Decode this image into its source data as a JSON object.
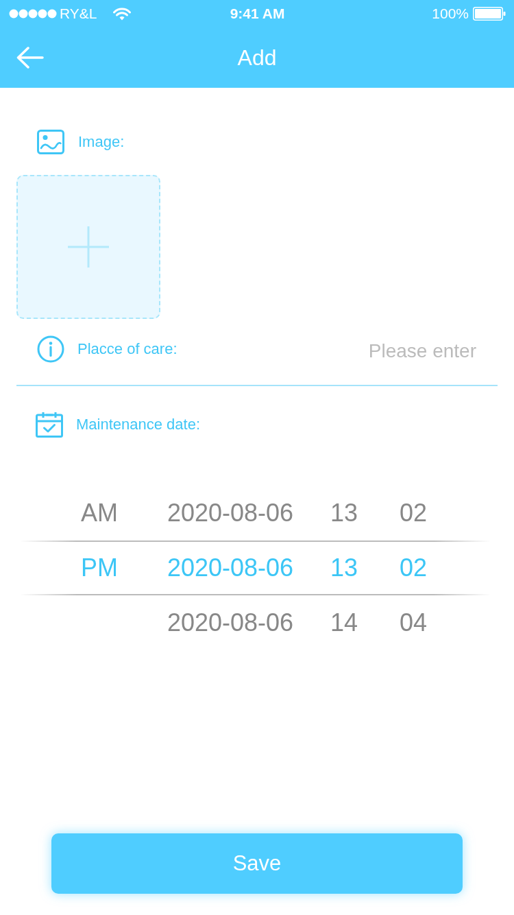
{
  "status_bar": {
    "carrier": "RY&L",
    "time": "9:41 AM",
    "battery": "100%"
  },
  "nav_bar": {
    "title": "Add"
  },
  "image_field": {
    "label": "Image:"
  },
  "place_field": {
    "label": "Placce of care:",
    "placeholder": "Please enter"
  },
  "date_field": {
    "label": "Maintenance date:"
  },
  "picker": {
    "rows": [
      {
        "period": "AM",
        "date": "2020-08-06",
        "hour": "13",
        "minute": "02",
        "selected": false
      },
      {
        "period": "PM",
        "date": "2020-08-06",
        "hour": "13",
        "minute": "02",
        "selected": true
      },
      {
        "date": "2020-08-06",
        "hour": "14",
        "minute": "04",
        "selected": false
      }
    ]
  },
  "save_button": {
    "label": "Save"
  }
}
